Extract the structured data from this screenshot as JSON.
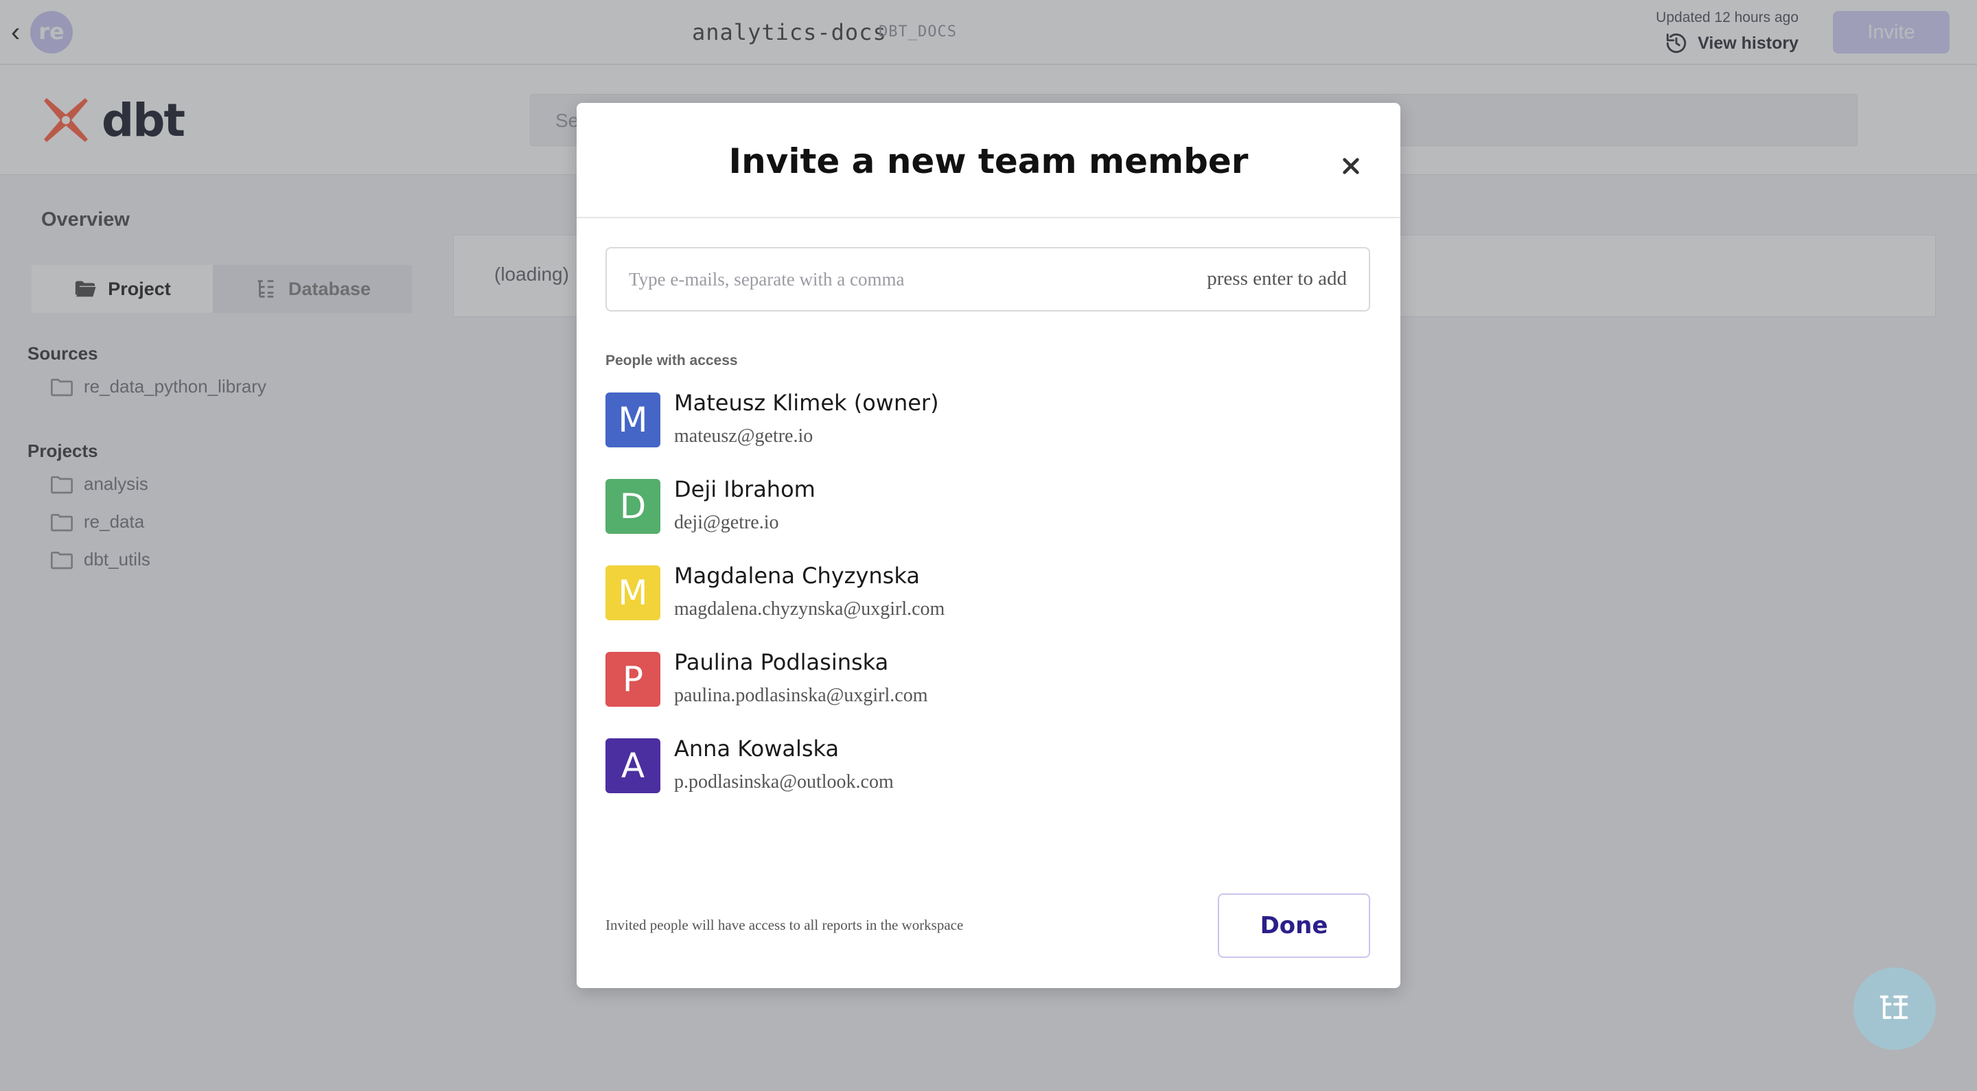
{
  "topbar": {
    "workspace_initials": "re",
    "doc_title": "analytics-docs",
    "doc_tag": "DBT_DOCS",
    "updated_text": "Updated 12 hours ago",
    "view_history_label": "View history",
    "invite_label": "Invite"
  },
  "docs": {
    "logo_text": "dbt",
    "search_placeholder": "Se",
    "overview_label": "Overview",
    "tabs": [
      {
        "label": "Project",
        "active": true,
        "icon": "folder-open-icon"
      },
      {
        "label": "Database",
        "active": false,
        "icon": "tree-icon"
      }
    ],
    "sources_label": "Sources",
    "sources": [
      {
        "label": "re_data_python_library"
      }
    ],
    "projects_label": "Projects",
    "projects": [
      {
        "label": "analysis"
      },
      {
        "label": "re_data"
      },
      {
        "label": "dbt_utils"
      }
    ],
    "loading_text": "(loading)"
  },
  "modal": {
    "title": "Invite a new team member",
    "input_placeholder": "Type e-mails, separate with a comma",
    "input_hint": "press enter to add",
    "people_label": "People with access",
    "people": [
      {
        "initial": "M",
        "name": "Mateusz Klimek (owner)",
        "email": "mateusz@getre.io",
        "color": "#4566c6"
      },
      {
        "initial": "D",
        "name": "Deji Ibrahom",
        "email": "deji@getre.io",
        "color": "#54ae6c"
      },
      {
        "initial": "M",
        "name": "Magdalena Chyzynska",
        "email": "magdalena.chyzynska@uxgirl.com",
        "color": "#f2d33a"
      },
      {
        "initial": "P",
        "name": "Paulina Podlasinska",
        "email": "paulina.podlasinska@uxgirl.com",
        "color": "#de5353"
      },
      {
        "initial": "A",
        "name": "Anna Kowalska",
        "email": "p.podlasinska@outlook.com",
        "color": "#4b2fa0"
      }
    ],
    "footer_note": "Invited people will have access to all reports in the workspace",
    "done_label": "Done"
  },
  "colors": {
    "accent": "#2b1f8a",
    "invite_button": "#d6d3fa",
    "fab": "#a2c4d0"
  }
}
